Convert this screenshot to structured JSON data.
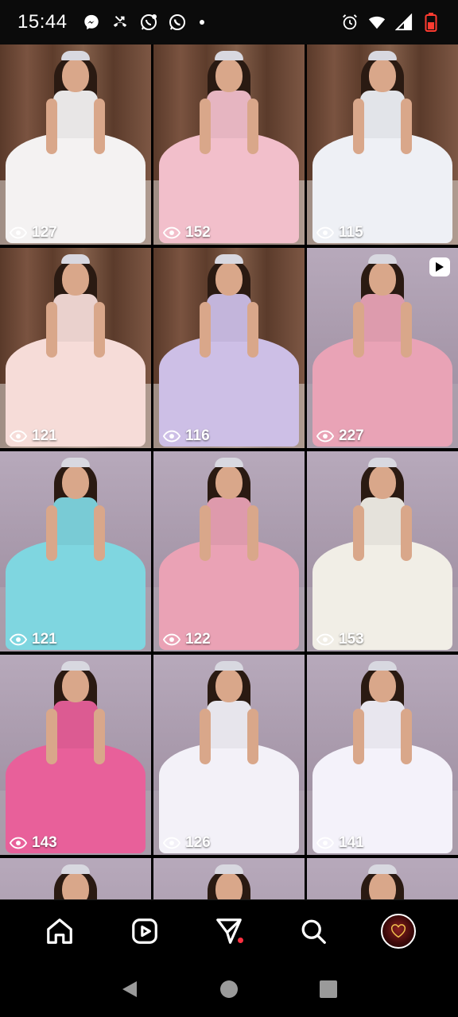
{
  "status_bar": {
    "time": "15:44",
    "left_icons": [
      "messenger-icon",
      "missed-call-icon",
      "whatsapp-business-icon",
      "whatsapp-icon",
      "more-notifications-dot"
    ],
    "right_icons": [
      "alarm-icon",
      "wifi-icon",
      "signal-icon",
      "battery-low-icon"
    ],
    "battery_color": "#ff3b30"
  },
  "grid": {
    "posts": [
      {
        "views": "127",
        "dress_color": "#f4f2f2",
        "wall": "wood",
        "is_reel": false
      },
      {
        "views": "152",
        "dress_color": "#f2bfcb",
        "wall": "wood",
        "is_reel": false
      },
      {
        "views": "115",
        "dress_color": "#eef0f5",
        "wall": "wood",
        "is_reel": false
      },
      {
        "views": "121",
        "dress_color": "#f6dcd8",
        "wall": "wood",
        "is_reel": false
      },
      {
        "views": "116",
        "dress_color": "#cdbfe6",
        "wall": "wood",
        "is_reel": false
      },
      {
        "views": "227",
        "dress_color": "#e9a3b6",
        "wall": "mauve",
        "is_reel": true
      },
      {
        "views": "121",
        "dress_color": "#7fd6e0",
        "wall": "mauve",
        "is_reel": false
      },
      {
        "views": "122",
        "dress_color": "#eaa2b5",
        "wall": "mauve",
        "is_reel": false
      },
      {
        "views": "153",
        "dress_color": "#f1eee6",
        "wall": "mauve",
        "is_reel": false
      },
      {
        "views": "143",
        "dress_color": "#e8609a",
        "wall": "mauve",
        "is_reel": false
      },
      {
        "views": "126",
        "dress_color": "#f3f1f8",
        "wall": "mauve",
        "is_reel": false
      },
      {
        "views": "141",
        "dress_color": "#f4f2fa",
        "wall": "mauve",
        "is_reel": false
      },
      {
        "views": "",
        "dress_color": "#cfc8d4",
        "wall": "mauve",
        "is_reel": false
      },
      {
        "views": "",
        "dress_color": "#cfc8d4",
        "wall": "mauve",
        "is_reel": false
      },
      {
        "views": "",
        "dress_color": "#cfc8d4",
        "wall": "mauve",
        "is_reel": false
      }
    ]
  },
  "bottom_nav": {
    "items": [
      "home-icon",
      "reels-icon",
      "direct-messages-icon",
      "search-icon",
      "profile-avatar"
    ],
    "notification_color": "#ff3040"
  },
  "system_nav": {
    "items": [
      "back-icon",
      "home-button-icon",
      "recents-icon"
    ]
  }
}
